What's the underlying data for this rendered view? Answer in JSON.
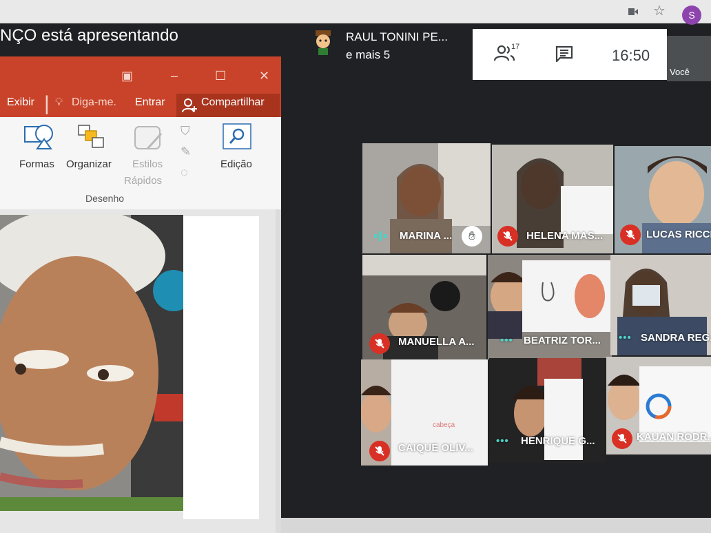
{
  "browser": {
    "profile_initial": "S"
  },
  "meet": {
    "presenting_text": "NÇO está apresentando",
    "presenter_name": "RAUL TONINI PE...",
    "presenter_more": "e mais 5",
    "people_count": "17",
    "clock": "16:50",
    "self_label": "Você"
  },
  "ppt": {
    "menu": {
      "exibir": "Exibir",
      "tell_me": "Diga-me.",
      "sign_in": "Entrar",
      "share": "Compartilhar"
    },
    "ribbon": {
      "shapes": "Formas",
      "arrange": "Organizar",
      "quick_styles_1": "Estilos",
      "quick_styles_2": "Rápidos",
      "editing": "Edição",
      "group_drawing": "Desenho"
    }
  },
  "participants": [
    {
      "name": "MARINA ...",
      "status": "speaking",
      "hand": true
    },
    {
      "name": "HELENA MAS...",
      "status": "muted"
    },
    {
      "name": "LUCAS RICCI",
      "status": "muted"
    },
    {
      "name": "MANUELLA A...",
      "status": "muted"
    },
    {
      "name": "BEATRIZ TOR...",
      "status": "quiet"
    },
    {
      "name": "SANDRA REG...",
      "status": "quiet"
    },
    {
      "name": "CAIQUE OLIV...",
      "status": "muted"
    },
    {
      "name": "HENRIQUE G...",
      "status": "quiet"
    },
    {
      "name": "KAUAN RODR...",
      "status": "muted"
    }
  ],
  "colors": {
    "ppt_red": "#c8432a",
    "mute_red": "#d93025",
    "speak_teal": "#4fd1c5"
  }
}
